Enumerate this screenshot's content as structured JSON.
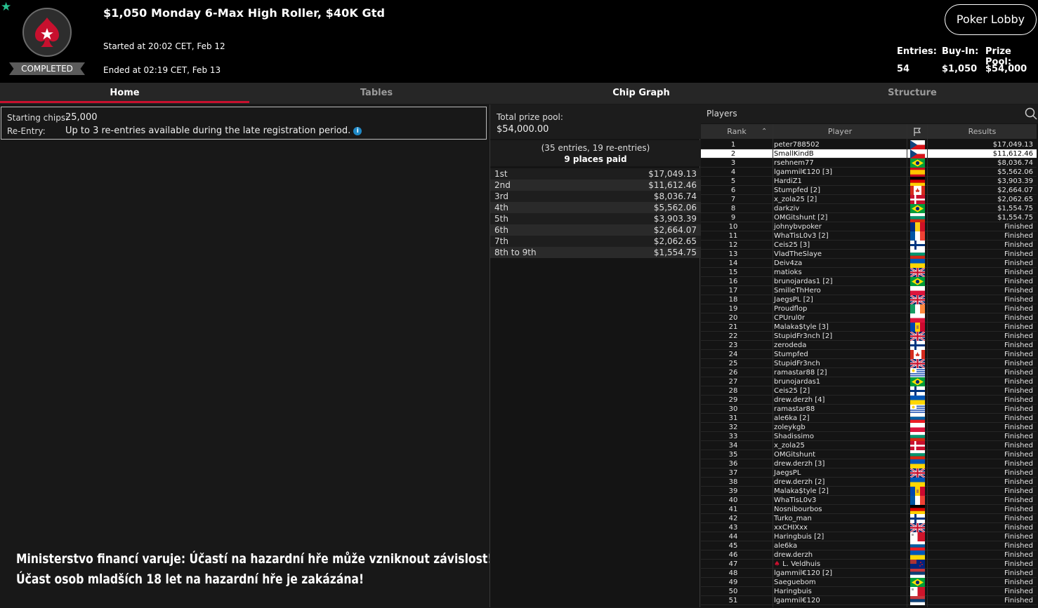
{
  "header": {
    "title": "$1,050 Monday 6-Max High Roller, $40K Gtd",
    "started": "Started at 20:02 CET, Feb 12",
    "ended": "Ended at 02:19 CET, Feb 13",
    "status_badge": "COMPLETED",
    "lobby_button": "Poker Lobby",
    "stats": [
      {
        "label": "Entries:",
        "value": "54"
      },
      {
        "label": "Buy-In:",
        "value": "$1,050"
      },
      {
        "label": "Prize Pool:",
        "value": "$54,000"
      }
    ],
    "accent_color": "#c8102e"
  },
  "tabs": [
    {
      "label": "Home",
      "active": true
    },
    {
      "label": "Tables",
      "active": false
    },
    {
      "label": "Chip Graph",
      "active": false
    },
    {
      "label": "Structure",
      "active": false
    }
  ],
  "info": {
    "starting_chips_label": "Starting chips:",
    "starting_chips_value": "25,000",
    "reentry_label": "Re-Entry:",
    "reentry_value": "Up to 3 re-entries available during the late registration period.",
    "info_icon": "i"
  },
  "warning": {
    "line1": "Ministerstvo financí varuje: Účastí na hazardní hře může vzniknout závislost!",
    "line2": "Účast osob mladších 18 let na hazardní hře je zakázána!"
  },
  "prize": {
    "label": "Total prize pool:",
    "value": "$54,000.00",
    "entries": "(35 entries, 19 re-entries)",
    "places": "9 places paid",
    "payouts": [
      {
        "place": "1st",
        "amount": "$17,049.13"
      },
      {
        "place": "2nd",
        "amount": "$11,612.46"
      },
      {
        "place": "3rd",
        "amount": "$8,036.74"
      },
      {
        "place": "4th",
        "amount": "$5,562.06"
      },
      {
        "place": "5th",
        "amount": "$3,903.39"
      },
      {
        "place": "6th",
        "amount": "$2,664.07"
      },
      {
        "place": "7th",
        "amount": "$2,062.65"
      },
      {
        "place": "8th to 9th",
        "amount": "$1,554.75"
      }
    ]
  },
  "players": {
    "title": "Players",
    "columns": {
      "rank": "Rank",
      "player": "Player",
      "results": "Results"
    },
    "selected_rank": 2,
    "rows": [
      {
        "rank": "1",
        "name": "peter788502",
        "flag": "CZ",
        "result": "$17,049.13"
      },
      {
        "rank": "2",
        "name": "SmallKindB",
        "flag": "CZ",
        "result": "$11,612.46"
      },
      {
        "rank": "3",
        "name": "rsehnem77",
        "flag": "BR",
        "result": "$8,036.74"
      },
      {
        "rank": "4",
        "name": "lgammil€120 [3]",
        "flag": "ES",
        "result": "$5,562.06"
      },
      {
        "rank": "5",
        "name": "HardiZ1",
        "flag": "DE",
        "result": "$3,903.39"
      },
      {
        "rank": "6",
        "name": "Stumpfed [2]",
        "flag": "CA",
        "result": "$2,664.07"
      },
      {
        "rank": "7",
        "name": "x_zola25 [2]",
        "flag": "DK",
        "result": "$2,062.65"
      },
      {
        "rank": "8",
        "name": "darkziv",
        "flag": "BR",
        "result": "$1,554.75"
      },
      {
        "rank": "9",
        "name": "OMGitshunt [2]",
        "flag": "BG",
        "result": "$1,554.75"
      },
      {
        "rank": "10",
        "name": "johnybvpoker",
        "flag": "RO",
        "result": "Finished"
      },
      {
        "rank": "11",
        "name": "WhaTisL0v3 [2]",
        "flag": "FR",
        "result": "Finished"
      },
      {
        "rank": "12",
        "name": "Ceis25 [3]",
        "flag": "FI",
        "result": "Finished"
      },
      {
        "rank": "13",
        "name": "VladTheSlaye",
        "flag": "BG",
        "result": "Finished"
      },
      {
        "rank": "14",
        "name": "Deiv4za",
        "flag": "UA",
        "result": "Finished"
      },
      {
        "rank": "15",
        "name": "matioks",
        "flag": "GB",
        "result": "Finished"
      },
      {
        "rank": "16",
        "name": "brunojardas1 [2]",
        "flag": "BR",
        "result": "Finished"
      },
      {
        "rank": "17",
        "name": "SmilleThHero",
        "flag": "PL",
        "result": "Finished"
      },
      {
        "rank": "18",
        "name": "JaegsPL [2]",
        "flag": "GB",
        "result": "Finished"
      },
      {
        "rank": "19",
        "name": "Proudflop",
        "flag": "IE",
        "result": "Finished"
      },
      {
        "rank": "20",
        "name": "CPUrul0r",
        "flag": "PL",
        "result": "Finished"
      },
      {
        "rank": "21",
        "name": "Malaka$tyle [3]",
        "flag": "MD",
        "result": "Finished"
      },
      {
        "rank": "22",
        "name": "StupidFr3nch [2]",
        "flag": "GB",
        "result": "Finished"
      },
      {
        "rank": "23",
        "name": "zerodeda",
        "flag": "FI",
        "result": "Finished"
      },
      {
        "rank": "24",
        "name": "Stumpfed",
        "flag": "CA",
        "result": "Finished"
      },
      {
        "rank": "25",
        "name": "StupidFr3nch",
        "flag": "GB",
        "result": "Finished"
      },
      {
        "rank": "26",
        "name": "ramastar88 [2]",
        "flag": "UY",
        "result": "Finished"
      },
      {
        "rank": "27",
        "name": "brunojardas1",
        "flag": "BR",
        "result": "Finished"
      },
      {
        "rank": "28",
        "name": "Ceis25 [2]",
        "flag": "FI",
        "result": "Finished"
      },
      {
        "rank": "29",
        "name": "drew.derzh [4]",
        "flag": "UA",
        "result": "Finished"
      },
      {
        "rank": "30",
        "name": "ramastar88",
        "flag": "UY",
        "result": "Finished"
      },
      {
        "rank": "31",
        "name": "ale6ka [2]",
        "flag": "SI",
        "result": "Finished"
      },
      {
        "rank": "32",
        "name": "zoleykgb",
        "flag": "PL",
        "result": "Finished"
      },
      {
        "rank": "33",
        "name": "Shadissimo",
        "flag": "BG",
        "result": "Finished"
      },
      {
        "rank": "34",
        "name": "x_zola25",
        "flag": "DK",
        "result": "Finished"
      },
      {
        "rank": "35",
        "name": "OMGitshunt",
        "flag": "BG",
        "result": "Finished"
      },
      {
        "rank": "36",
        "name": "drew.derzh [3]",
        "flag": "UA",
        "result": "Finished"
      },
      {
        "rank": "37",
        "name": "JaegsPL",
        "flag": "GB",
        "result": "Finished"
      },
      {
        "rank": "38",
        "name": "drew.derzh [2]",
        "flag": "UA",
        "result": "Finished"
      },
      {
        "rank": "39",
        "name": "Malaka$tyle [2]",
        "flag": "MD",
        "result": "Finished"
      },
      {
        "rank": "40",
        "name": "WhaTisL0v3",
        "flag": "FR",
        "result": "Finished"
      },
      {
        "rank": "41",
        "name": "Nosnibourbos",
        "flag": "DE",
        "result": "Finished"
      },
      {
        "rank": "42",
        "name": "Turko_man",
        "flag": "FI",
        "result": "Finished"
      },
      {
        "rank": "43",
        "name": "xxCHIXxx",
        "flag": "GB",
        "result": "Finished"
      },
      {
        "rank": "44",
        "name": "Haringbuis [2]",
        "flag": "MT",
        "result": "Finished"
      },
      {
        "rank": "45",
        "name": "ale6ka",
        "flag": "SI",
        "result": "Finished"
      },
      {
        "rank": "46",
        "name": "drew.derzh",
        "flag": "UA",
        "result": "Finished"
      },
      {
        "rank": "47",
        "name": "L. Veldhuis",
        "flag": "NZ",
        "result": "Finished",
        "badge": true
      },
      {
        "rank": "48",
        "name": "lgammil€120 [2]",
        "flag": "RS",
        "result": "Finished"
      },
      {
        "rank": "49",
        "name": "Saeguebom",
        "flag": "BR",
        "result": "Finished"
      },
      {
        "rank": "50",
        "name": "Haringbuis",
        "flag": "MT",
        "result": "Finished"
      },
      {
        "rank": "51",
        "name": "lgammil€120",
        "flag": "RS",
        "result": "Finished"
      }
    ]
  }
}
